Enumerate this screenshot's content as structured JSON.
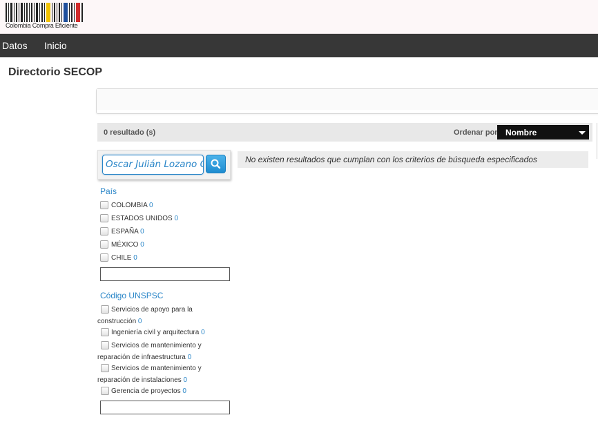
{
  "header": {
    "logo_text": "Colombia Compra Eficiente"
  },
  "nav": {
    "items": [
      "Datos",
      "Inicio"
    ]
  },
  "page": {
    "title": "Directorio SECOP"
  },
  "results": {
    "count_text": "0 resultado (s)",
    "sort_label": "Ordenar por:",
    "sort_value": "Nombre",
    "empty_message": "No existen resultados que cumplan con los criterios de búsqueda especificados"
  },
  "search": {
    "value": "Oscar Julián Lozano C"
  },
  "facets": {
    "pais": {
      "title": "País",
      "items": [
        {
          "label": "COLOMBIA",
          "count": "0"
        },
        {
          "label": "ESTADOS UNIDOS",
          "count": "0"
        },
        {
          "label": "ESPAÑA",
          "count": "0"
        },
        {
          "label": "MÉXICO",
          "count": "0"
        },
        {
          "label": "CHILE",
          "count": "0"
        }
      ],
      "filter_value": ""
    },
    "unspsc": {
      "title": "Código UNSPSC",
      "items": [
        {
          "line1": "Servicios de apoyo para la",
          "line2": "construcción",
          "count": "0"
        },
        {
          "line1": "Ingeniería civil y arquitectura",
          "line2": "",
          "count": "0"
        },
        {
          "line1": "Servicios de mantenimiento y",
          "line2": "reparación de infraestructura",
          "count": "0"
        },
        {
          "line1": "Servicios de mantenimiento y",
          "line2": "reparación de instalaciones",
          "count": "0"
        },
        {
          "line1": "Gerencia de proyectos",
          "line2": "",
          "count": "0"
        }
      ],
      "filter_value": ""
    }
  },
  "colors": {
    "accent": "#2a86c8",
    "navbar": "#373737",
    "sort_bg": "#111111"
  },
  "icons": {
    "search_button": "search-icon",
    "sort_caret": "chevron-down-icon"
  }
}
